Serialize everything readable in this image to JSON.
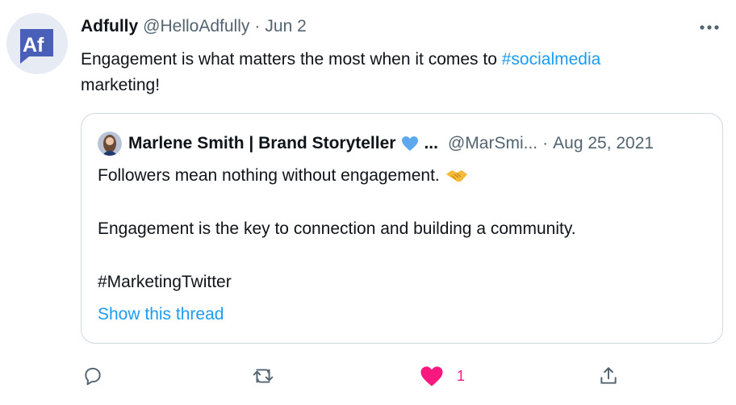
{
  "tweet": {
    "author_name": "Adfully",
    "handle": "@HelloAdfully",
    "separator": "·",
    "date": "Jun 2",
    "text_before": "Engagement is what matters the most when it comes to ",
    "hashtag": "#socialmedia",
    "text_after": "marketing!",
    "avatar_initials": "Af"
  },
  "quoted": {
    "author_name": "Marlene Smith | Brand Storyteller",
    "ellipsis": "...",
    "handle": "@MarSmi...",
    "date_separator": "·",
    "date": "Aug 25, 2021",
    "line1": "Followers mean nothing without engagement.",
    "line2": "Engagement is the key to connection and building a community.",
    "line3": "#MarketingTwitter",
    "show_thread": "Show this thread"
  },
  "actions": {
    "like_count": "1"
  },
  "colors": {
    "accent": "#1d9bf0",
    "like": "#f91880",
    "muted": "#536471",
    "verified_heart": "#5ea9ee"
  },
  "icons": [
    "more-icon",
    "reply-icon",
    "retweet-icon",
    "heart-icon",
    "share-icon",
    "handshake-icon",
    "blue-heart-icon"
  ]
}
